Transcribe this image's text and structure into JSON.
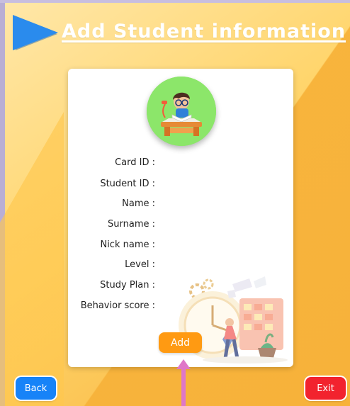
{
  "header": {
    "title": "Add Student information",
    "arrow_icon": "play-triangle-icon"
  },
  "avatar": {
    "icon": "student-at-desk-icon",
    "bg_color": "#8ce66a"
  },
  "form": {
    "labels": [
      "Card ID :",
      "Student ID :",
      "Name :",
      "Surname :",
      "Nick name :",
      "Level :",
      "Study Plan :",
      "Behavior score :"
    ]
  },
  "illustration": {
    "icon": "clock-calendar-illustration"
  },
  "buttons": {
    "add": "Add",
    "back": "Back",
    "exit": "Exit"
  },
  "annotation": {
    "icon": "pink-up-arrow"
  },
  "colors": {
    "background": "#f7b23a",
    "title_arrow": "#2a8bed",
    "add_button": "#ff9a12",
    "back_button": "#1783f8",
    "exit_button": "#f2232e",
    "annotation_arrow": "#df77c8"
  }
}
